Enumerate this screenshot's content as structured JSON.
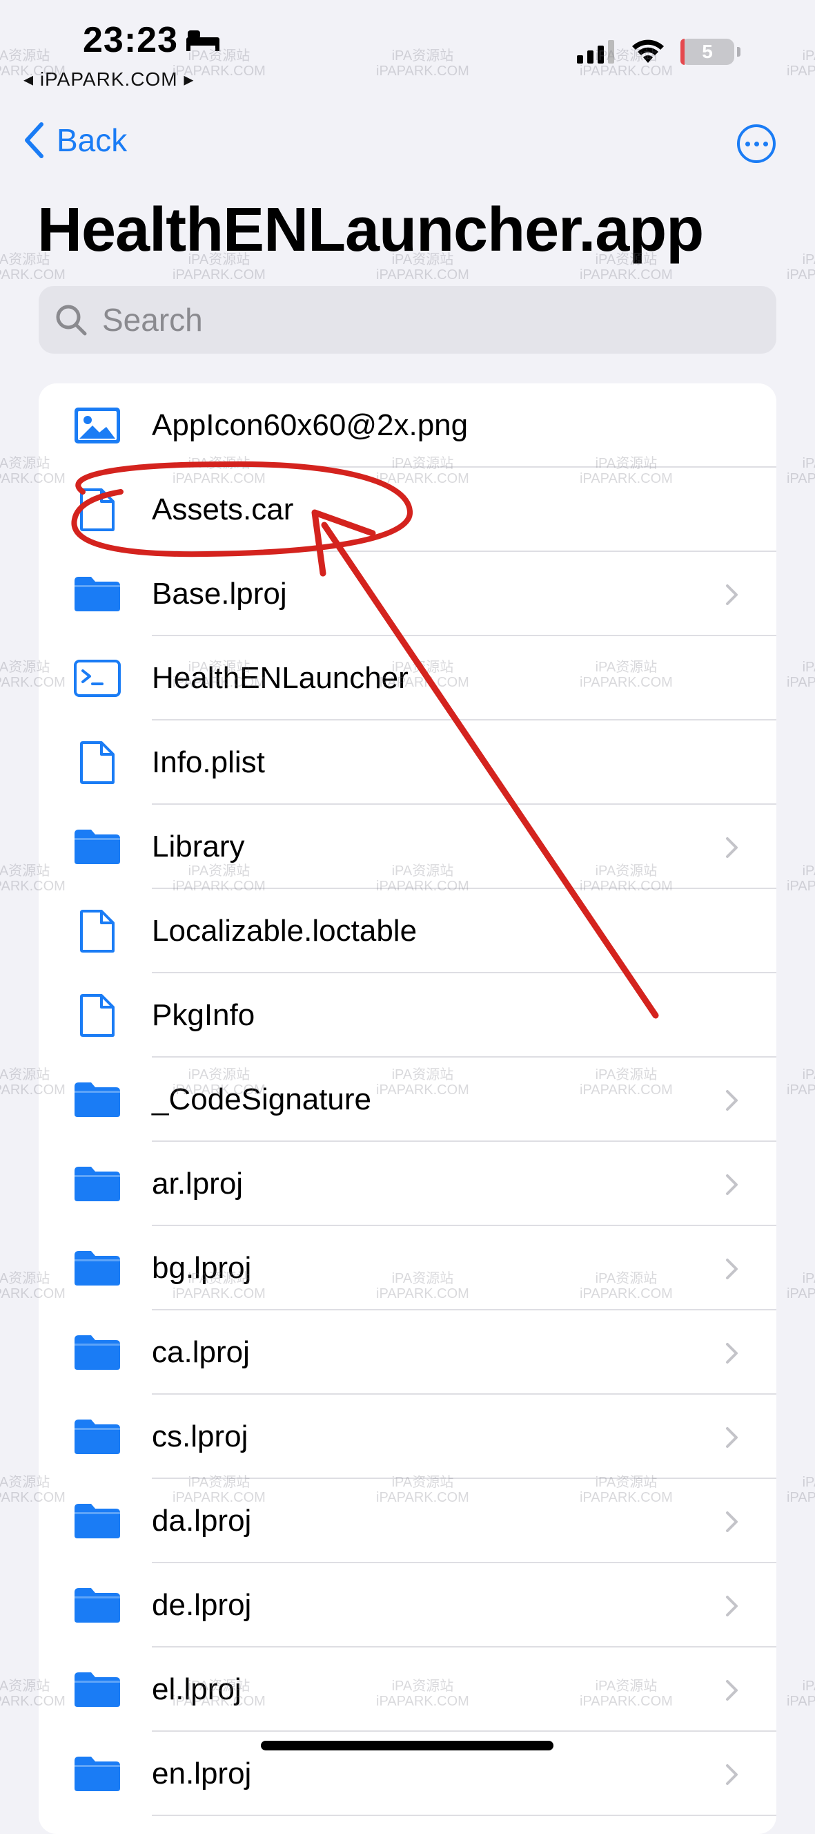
{
  "status": {
    "time": "23:23",
    "subtitle": "◂ iPAPARK.COM ▸",
    "battery": "5"
  },
  "nav": {
    "back_label": "Back"
  },
  "title": "HealthENLauncher.app",
  "search": {
    "placeholder": "Search"
  },
  "files": [
    {
      "name": "AppIcon60x60@2x.png",
      "icon": "image-icon",
      "folder": false
    },
    {
      "name": "Assets.car",
      "icon": "document-icon",
      "folder": false
    },
    {
      "name": "Base.lproj",
      "icon": "folder-icon",
      "folder": true
    },
    {
      "name": "HealthENLauncher",
      "icon": "terminal-icon",
      "folder": false
    },
    {
      "name": "Info.plist",
      "icon": "document-icon",
      "folder": false
    },
    {
      "name": "Library",
      "icon": "folder-icon",
      "folder": true
    },
    {
      "name": "Localizable.loctable",
      "icon": "document-icon",
      "folder": false
    },
    {
      "name": "PkgInfo",
      "icon": "document-icon",
      "folder": false
    },
    {
      "name": "_CodeSignature",
      "icon": "folder-icon",
      "folder": true
    },
    {
      "name": "ar.lproj",
      "icon": "folder-icon",
      "folder": true
    },
    {
      "name": "bg.lproj",
      "icon": "folder-icon",
      "folder": true
    },
    {
      "name": "ca.lproj",
      "icon": "folder-icon",
      "folder": true
    },
    {
      "name": "cs.lproj",
      "icon": "folder-icon",
      "folder": true
    },
    {
      "name": "da.lproj",
      "icon": "folder-icon",
      "folder": true
    },
    {
      "name": "de.lproj",
      "icon": "folder-icon",
      "folder": true
    },
    {
      "name": "el.lproj",
      "icon": "folder-icon",
      "folder": true
    },
    {
      "name": "en.lproj",
      "icon": "folder-icon",
      "folder": true
    }
  ],
  "watermark": {
    "line1": "iPA资源站",
    "line2": "iPAPARK.COM"
  },
  "colors": {
    "accent": "#1a7cf5",
    "annotation": "#d4231e",
    "background": "#f2f2f7"
  }
}
